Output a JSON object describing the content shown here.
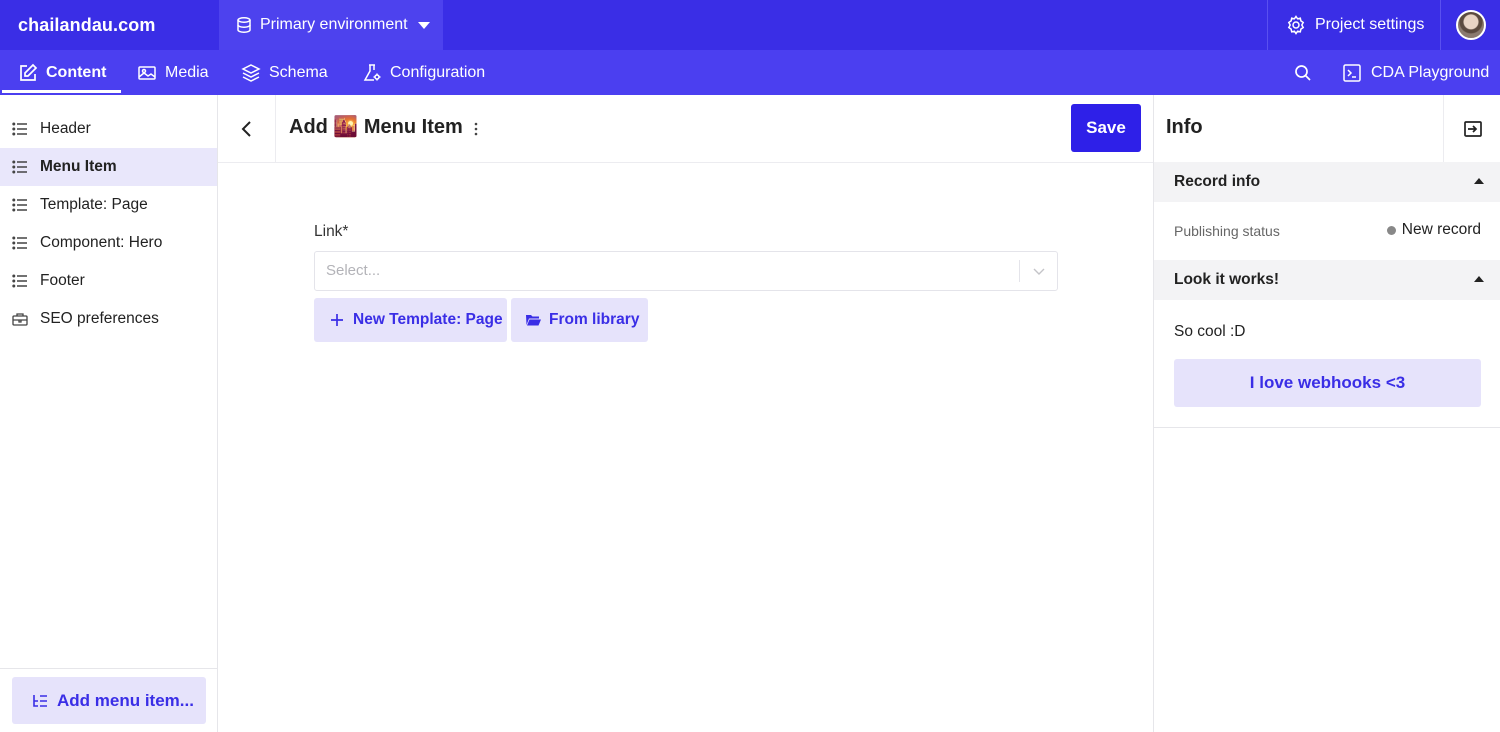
{
  "topbar": {
    "brand": "chailandau.com",
    "environment": "Primary environment",
    "project_settings": "Project settings"
  },
  "nav": {
    "items": [
      {
        "label": "Content",
        "icon": "edit-icon",
        "active": true
      },
      {
        "label": "Media",
        "icon": "image-icon",
        "active": false
      },
      {
        "label": "Schema",
        "icon": "layers-icon",
        "active": false
      },
      {
        "label": "Configuration",
        "icon": "flask-gear-icon",
        "active": false
      }
    ],
    "cda": "CDA Playground"
  },
  "sidebar": {
    "items": [
      {
        "label": "Header",
        "icon": "list-icon",
        "active": false
      },
      {
        "label": "Menu Item",
        "icon": "list-icon",
        "active": true
      },
      {
        "label": "Template: Page",
        "icon": "list-icon",
        "active": false
      },
      {
        "label": "Component: Hero",
        "icon": "list-icon",
        "active": false
      },
      {
        "label": "Footer",
        "icon": "list-icon",
        "active": false
      },
      {
        "label": "SEO preferences",
        "icon": "briefcase-icon",
        "active": false
      }
    ],
    "add_button": "Add menu item..."
  },
  "editor": {
    "title": "Add 🌇 Menu Item",
    "save": "Save",
    "field_label": "Link*",
    "select_placeholder": "Select...",
    "new_button": "New Template: Page",
    "library_button": "From library"
  },
  "info": {
    "title": "Info",
    "record_info": "Record info",
    "publishing_label": "Publishing status",
    "publishing_value": "New record",
    "status_color": "#888888",
    "section2": "Look it works!",
    "cool_text": "So cool :D",
    "webhook_button": "I love webhooks <3"
  },
  "colors": {
    "topbar": "#3a2ee6",
    "navbar": "#4b3ff0",
    "accent": "#2e20e8",
    "accent_soft": "#e6e3fb"
  }
}
